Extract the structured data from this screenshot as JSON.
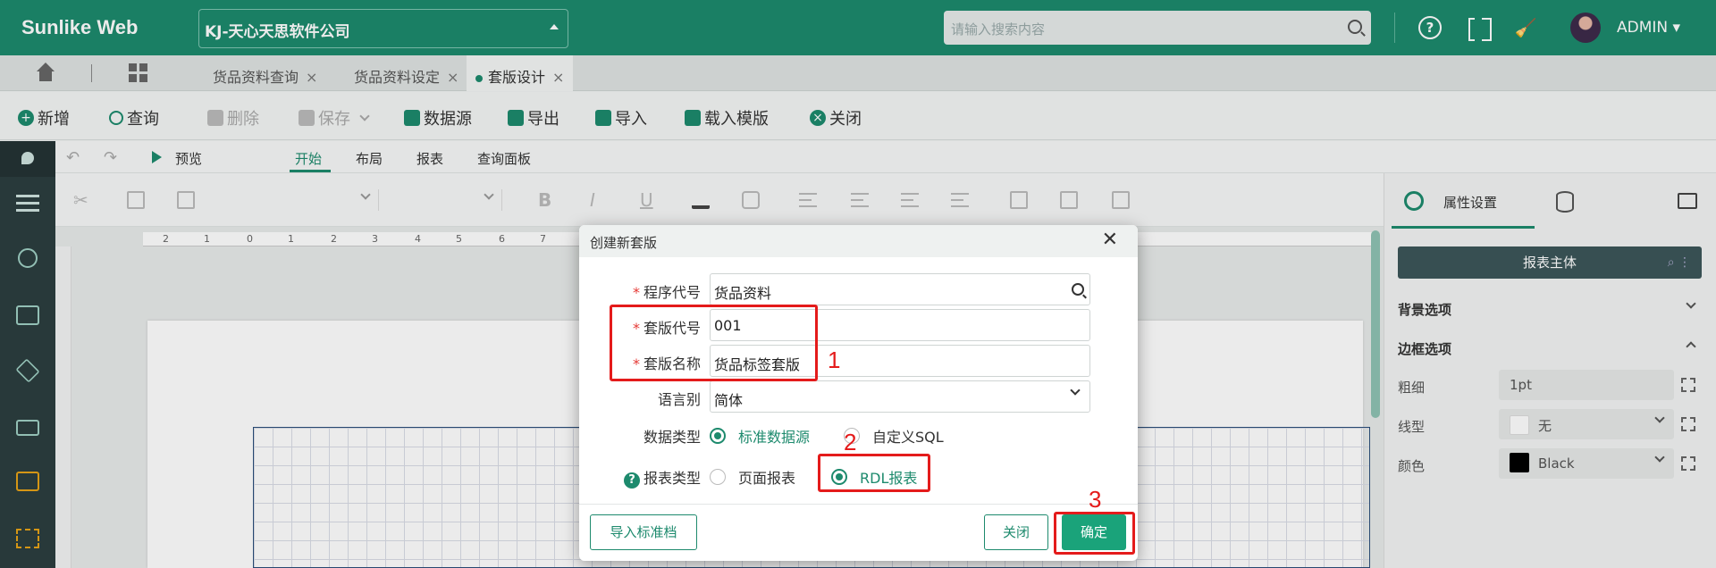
{
  "header": {
    "brand": "Sunlike Web",
    "company": "KJ-天心天思软件公司",
    "search_placeholder": "请输入搜索内容",
    "user": "ADMIN ▾",
    "help_icon_text": "?"
  },
  "tabs": {
    "items": [
      {
        "label": "货品资料查询",
        "close": "×"
      },
      {
        "label": "货品资料设定",
        "close": "×"
      },
      {
        "label": "套版设计",
        "close": "×"
      }
    ]
  },
  "toolbar": {
    "add": "新增",
    "query": "查询",
    "delete": "删除",
    "save": "保存",
    "datasource": "数据源",
    "export": "导出",
    "import": "导入",
    "load_template": "载入模版",
    "close": "关闭"
  },
  "ribbon": {
    "undo": "↶",
    "redo": "↷",
    "preview": "预览",
    "tabs": [
      "开始",
      "布局",
      "报表",
      "查询面板"
    ],
    "info": "i"
  },
  "format": {
    "bold": "B",
    "italic": "I",
    "underline": "U"
  },
  "ruler": {
    "ticks": [
      "2",
      "1",
      "0",
      "1",
      "2",
      "3",
      "4",
      "5",
      "6",
      "7"
    ]
  },
  "right_panel": {
    "tab_label": "属性设置",
    "main_button": "报表主体",
    "section_background": "背景选项",
    "section_border": "边框选项",
    "rows": [
      {
        "label": "粗细",
        "value": "1pt"
      },
      {
        "label": "线型",
        "value": "无"
      },
      {
        "label": "颜色",
        "value": "Black"
      }
    ],
    "swatch_colors": {
      "line": "#ffffff",
      "color": "#000000"
    }
  },
  "modal": {
    "title": "创建新套版",
    "close": "✕",
    "fields": {
      "program_code": {
        "label": "程序代号",
        "value": "货品资料"
      },
      "template_code": {
        "label": "套版代号",
        "value": "001"
      },
      "template_name": {
        "label": "套版名称",
        "value": "货品标签套版"
      },
      "language": {
        "label": "语言别",
        "value": "简体"
      }
    },
    "data_type": {
      "label": "数据类型",
      "options": [
        "标准数据源",
        "自定义SQL"
      ],
      "selected": "标准数据源"
    },
    "report_type": {
      "label": "报表类型",
      "help": "?",
      "options": [
        "页面报表",
        "RDL报表"
      ],
      "selected": "RDL报表"
    },
    "buttons": {
      "import": "导入标准档",
      "close": "关闭",
      "confirm": "确定"
    },
    "required_mark": "*"
  },
  "annotations": [
    "1",
    "2",
    "3"
  ],
  "colors": {
    "brand": "#1d8a6d",
    "annotation": "#e41b1b"
  }
}
